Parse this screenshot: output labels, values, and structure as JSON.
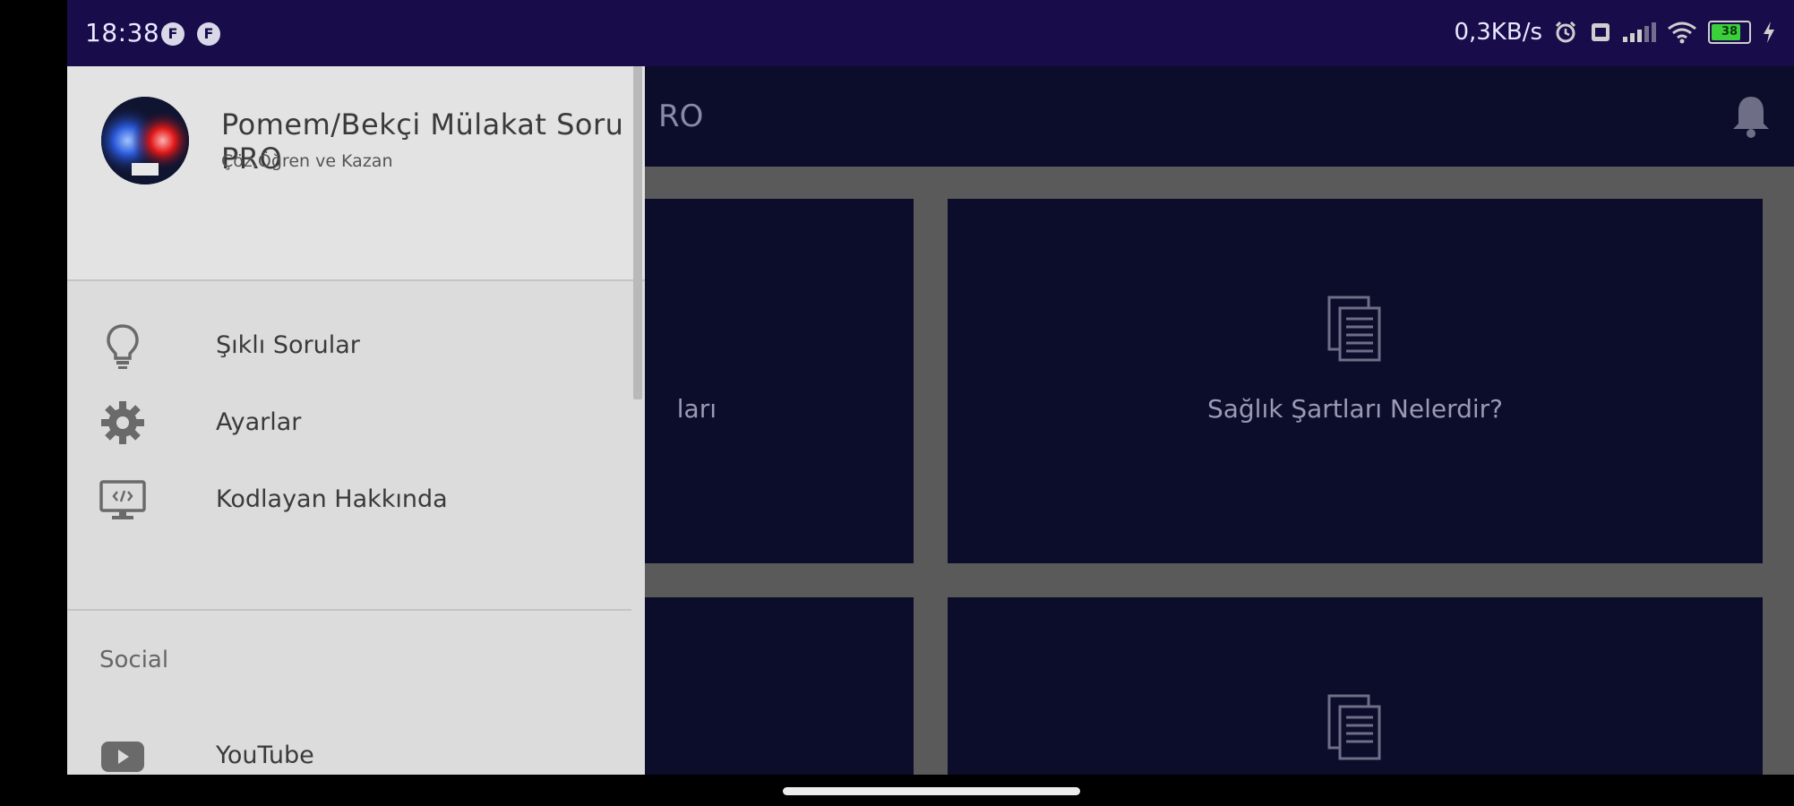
{
  "status_bar": {
    "time": "18:38",
    "notif_icons": [
      "F",
      "F"
    ],
    "net_speed": "0,3KB/s",
    "battery_level": "38"
  },
  "app_bar": {
    "title_partial": "RO"
  },
  "cards": [
    {
      "label": "ları"
    },
    {
      "label": "Sağlık Şartları Nelerdir?"
    },
    {
      "label": ""
    },
    {
      "label": ""
    }
  ],
  "drawer": {
    "title": "Pomem/Bekçi Mülakat Soru PRO",
    "subtitle": "Çöz,Öğren ve Kazan",
    "items": [
      {
        "label": "Şıklı Sorular",
        "icon": "lightbulb-icon"
      },
      {
        "label": "Ayarlar",
        "icon": "gear-icon"
      },
      {
        "label": "Kodlayan Hakkında",
        "icon": "monitor-code-icon"
      }
    ],
    "section_title": "Social",
    "social_items": [
      {
        "label": "YouTube",
        "icon": "youtube-icon"
      }
    ]
  },
  "colors": {
    "status_bar": "#180d4a",
    "app_bar": "#0c0c2b",
    "card": "#0c0c2b",
    "grid_bg": "#5a5a5a",
    "drawer_bg": "#dcdcdc"
  }
}
